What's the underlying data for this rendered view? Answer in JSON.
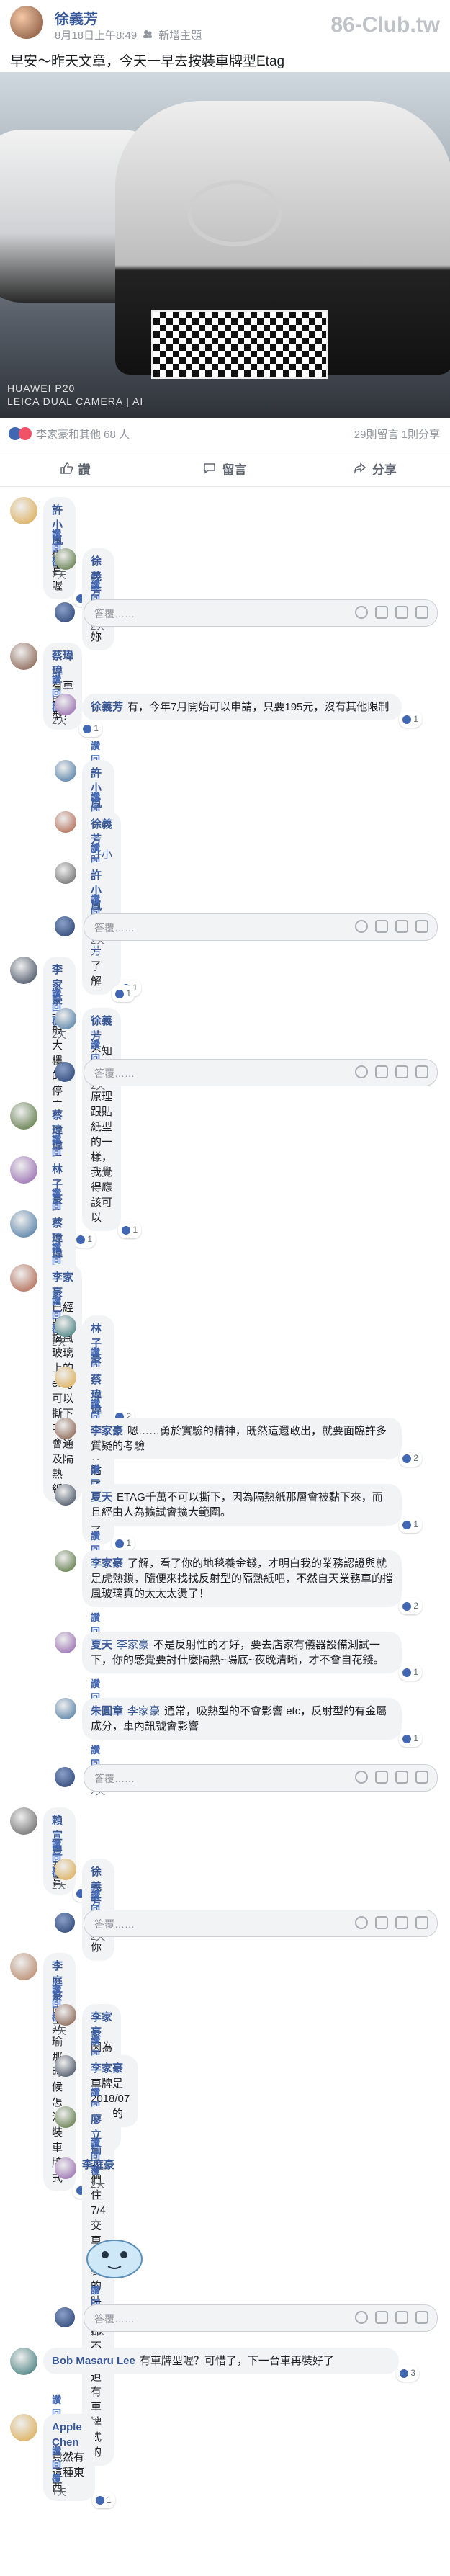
{
  "post": {
    "author": "徐義芳",
    "time": "8月18日上午8:49",
    "group_icon": "group-icon",
    "group": "新增主題",
    "watermark": "86-Club.tw",
    "text": "早安～昨天文章，今天一早去按裝車牌型Etag",
    "camera_line1": "HUAWEI P20",
    "camera_line2": "LEICA DUAL CAMERA | AI"
  },
  "reactions": {
    "who": "李家豪和其他 68 人",
    "counts": "29則留言  1則分享"
  },
  "actions": {
    "like": "讚",
    "comment": "留言",
    "share": "分享"
  },
  "reply_placeholder": "答覆……",
  "comments": [
    {
      "name": "許小嵐",
      "text": "供喜喔",
      "reactions": "1",
      "like": "讚",
      "reply": "回覆",
      "time": "2天",
      "replies": [
        {
          "name": "徐義芳",
          "text": "謝謝妳",
          "like": "讚",
          "reply": "回覆",
          "time": "2天"
        }
      ]
    },
    {
      "name": "蔡瑋瑋",
      "text": "有車牌型？",
      "reactions": "1",
      "like": "讚",
      "reply": "回覆",
      "time": "2天",
      "replies": [
        {
          "name": "徐義芳",
          "text": "有，今年7月開始可以申請，只要195元，沒有其他限制",
          "reactions": "1",
          "like": "讚",
          "reply": "回覆",
          "time": "2天"
        },
        {
          "name": "許小嵐",
          "tag": "徐義芳",
          "text": "貼在車號牌上面嗎",
          "like": "讚",
          "reply": "回覆",
          "time": "2天"
        },
        {
          "name": "徐義芳",
          "tag": "許小嵐",
          "text": "是車牌拆下，整一圈etag密框",
          "reactions": "1",
          "like": "讚",
          "reply": "回覆",
          "time": "2天"
        },
        {
          "name": "許小嵐",
          "tag": "徐義芳",
          "text": "了解",
          "reactions": "1",
          "like": "讚",
          "reply": "回覆",
          "time": "2天"
        }
      ]
    },
    {
      "name": "李家豪",
      "text": "一般大樓的停車場是否可以感應呢",
      "reactions": "1",
      "like": "讚",
      "reply": "回覆",
      "time": "2天",
      "replies": [
        {
          "name": "徐義芳",
          "text": "不知道耶，原理跟貼紙型的一樣，我覺得應該可以",
          "reactions": "1",
          "like": "讚",
          "reply": "回覆",
          "time": "2天"
        }
      ]
    },
    {
      "name": "蔡瑋瑋",
      "text": "嗯嗯",
      "like": "讚",
      "reply": "回覆",
      "time": "2天"
    },
    {
      "name": "林子豪",
      "text": "這樣應該不能裝車牌框了 不過很讚",
      "reactions": "1",
      "like": "讚",
      "reply": "回覆",
      "time": "2天"
    },
    {
      "name": "蔡瑋瑋",
      "text": "這樣也比較美觀",
      "reactions": "1",
      "like": "讚",
      "reply": "回覆",
      "time": "2天"
    },
    {
      "name": "李家豪",
      "text": "已經貼在擋風玻璃上的etag可以撕下嗎？會通及隔熱紙？",
      "like": "讚",
      "reply": "回覆",
      "time": "2天",
      "replies": [
        {
          "name": "林子豪",
          "text": "小心哦",
          "reactions": "2",
          "like": "讚",
          "reply": "回覆",
          "time": "2天"
        },
        {
          "name": "蔡瑋瑋",
          "text": "我覺得貼了就貼了",
          "reactions": "1",
          "like": "讚",
          "reply": "回覆",
          "time": "2天"
        },
        {
          "name": "李家豪",
          "text": "嗯……勇於實驗的精神，既然這還敢出，就要面臨許多質疑的考驗",
          "reactions": "2",
          "like": "讚",
          "reply": "回覆",
          "time": "2天"
        },
        {
          "name": "夏天",
          "text": "ETAG千萬不可以撕下，因為隔熱紙那層會被黏下來，而且經由人為擴試會擴大範圍。",
          "reactions": "1",
          "like": "讚",
          "reply": "回覆",
          "time": "2天"
        },
        {
          "name": "李家豪",
          "text": "了解，看了你的地毯養金錢，才明白我的業務認證與就是虎熱鎖，隨便來找找反射型的隔熱紙吧，不然自天業務車的擋風玻璃真的太太太燙了！",
          "reactions": "2",
          "like": "讚",
          "reply": "回覆",
          "time": "2天"
        },
        {
          "name": "夏天",
          "tag": "李家豪",
          "text": "不是反射性的才好，要去店家有儀器設備測試一下，你的感覺要討什麼隔熱~陽底~夜晚清晰，才不會自花錢。",
          "reactions": "1",
          "like": "讚",
          "reply": "回覆",
          "time": "2天"
        },
        {
          "name": "朱圓章",
          "tag": "李家豪",
          "text": "通常，吸熱型的不會影響 etc，反射型的有金屬成分，車內訊號會影響",
          "reactions": "1",
          "like": "讚",
          "reply": "回覆",
          "time": "2天"
        }
      ]
    },
    {
      "name": "賴宣豐",
      "text": "恭喜",
      "reactions": "2",
      "like": "讚",
      "reply": "回覆",
      "time": "2天",
      "replies": [
        {
          "name": "徐義芳",
          "text": "謝謝你",
          "like": "讚",
          "reply": "回覆",
          "time": "2天"
        }
      ]
    },
    {
      "name": "李庭豪",
      "text": "廖立瑜那時候怎沒裝車牌式",
      "reactions": "1",
      "like": "讚",
      "reply": "回覆",
      "time": "2天",
      "replies": [
        {
          "name": "李家豪",
          "text": "因為我買到最高貴！的和泰",
          "like": "讚",
          "reply": "回覆",
          "time": "2天"
        },
        {
          "name": "李家豪",
          "text": "車牌是2018/07開始的",
          "like": "讚",
          "reply": "回覆",
          "time": "2天"
        },
        {
          "name": "廖立瑜",
          "text": "我們住7/4交車的 裝的時候都不知道有車牌式的",
          "like": "讚",
          "reply": "回覆",
          "time": "2天"
        },
        {
          "name": "李庭豪",
          "text": "",
          "sticker": "sticker",
          "like": "讚",
          "reply": "回覆",
          "time": "1天"
        }
      ]
    },
    {
      "name": "Bob Masaru Lee",
      "text": "有車牌型喔？可惜了，下一台車再裝好了",
      "reactions": "3",
      "like": "讚",
      "reply": "回覆",
      "time": "2天"
    },
    {
      "name": "Apple Chen",
      "text": "竟然有這種東西",
      "reactions": "1",
      "like": "讚",
      "reply": "回覆",
      "time": "1天"
    }
  ],
  "colors": {
    "name_blue": "#385898",
    "like_blue": "#4267b2",
    "love_red": "#f25268",
    "bubble_bg": "#f2f3f5"
  }
}
